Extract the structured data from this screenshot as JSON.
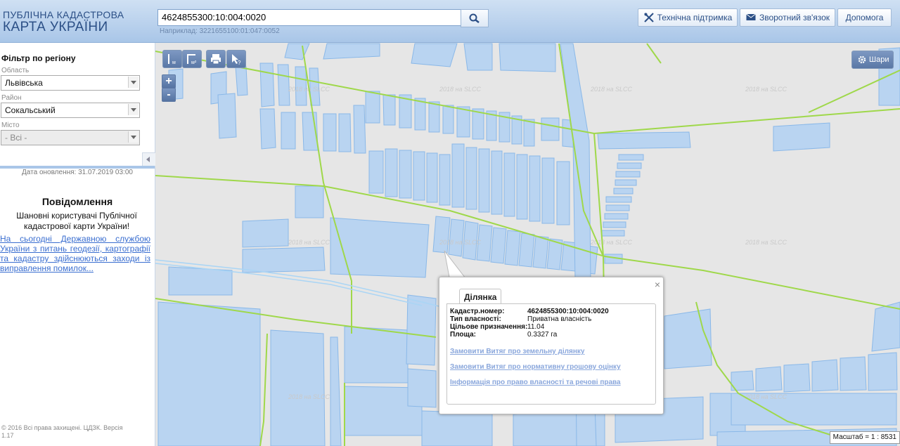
{
  "header": {
    "logo_line1": "ПУБЛІЧНА КАДАСТРОВА",
    "logo_line2": "КАРТА УКРАЇНИ",
    "search_value": "4624855300:10:004:0020",
    "search_hint": "Наприклад: 3221655100:01:047:0052",
    "support_label": "Технічна підтримка",
    "feedback_label": "Зворотний зв'язок",
    "help_label": "Допомога"
  },
  "sidebar": {
    "filter_title": "Фільтр по регіону",
    "oblast_label": "Область",
    "oblast_value": "Львівська",
    "raion_label": "Район",
    "raion_value": "Сокальський",
    "misto_label": "Місто",
    "misto_value": "- Всі -",
    "update_date": "Дата оновлення: 31.07.2019 03:00",
    "news_title": "Повідомлення",
    "news_text": "Шановні користувачі Публічної кадастрової карти України!",
    "news_link": "На сьогодні Державною службою України з питань геодезії, картографії та кадастру здійснюються заходи із виправлення помилок...",
    "copyright": "© 2016 Всі права захищені. ЦДЗК. Версія 1.17"
  },
  "map": {
    "layers_label": "Шари",
    "zoom_in": "+",
    "zoom_out": "-",
    "scale": "Масштаб = 1 : 8531",
    "watermark": "2018 на SLCC",
    "colors": {
      "parcel_fill": "#b9d4f1",
      "parcel_stroke": "#8ab8e8",
      "boundary": "#9fd84a",
      "background": "#e6e6e6"
    }
  },
  "popup": {
    "tab_label": "Ділянка",
    "close": "×",
    "rows": [
      {
        "key": "Кадастр.номер:",
        "value": "4624855300:10:004:0020",
        "bold": true
      },
      {
        "key": "Тип власності:",
        "value": "Приватна власність"
      },
      {
        "key": "Цільове призначення:",
        "value": "11.04"
      },
      {
        "key": "Площа:",
        "value": "0.3327 га"
      }
    ],
    "links": [
      "Замовити Витяг про земельну ділянку",
      "Замовити Витяг про нормативну грошову оцінку",
      "Інформація про право власності та речові права"
    ]
  }
}
